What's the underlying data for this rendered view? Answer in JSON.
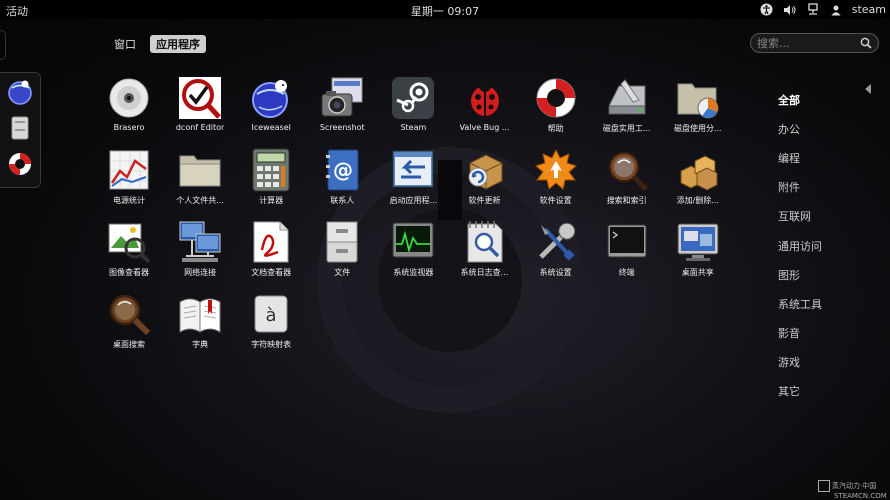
{
  "topbar": {
    "activities": "活动",
    "clock": "星期一 09:07",
    "user": "steam"
  },
  "view_switch": {
    "windows": "窗口",
    "applications": "应用程序"
  },
  "search": {
    "placeholder": "搜索..."
  },
  "apps": [
    {
      "label": "Brasero",
      "icon": "disc-icon"
    },
    {
      "label": "dconf Editor",
      "icon": "dconf-icon"
    },
    {
      "label": "Iceweasel",
      "icon": "iceweasel-icon"
    },
    {
      "label": "Screenshot",
      "icon": "camera-icon"
    },
    {
      "label": "Steam",
      "icon": "steam-icon"
    },
    {
      "label": "Valve Bug ...",
      "icon": "ladybug-icon"
    },
    {
      "label": "帮助",
      "icon": "lifebuoy-icon"
    },
    {
      "label": "磁盘实用工...",
      "icon": "disk-utility-icon"
    },
    {
      "label": "磁盘使用分...",
      "icon": "disk-usage-icon"
    },
    {
      "label": "电源统计",
      "icon": "power-stats-icon"
    },
    {
      "label": "个人文件共...",
      "icon": "folder-share-icon"
    },
    {
      "label": "计算器",
      "icon": "calculator-icon"
    },
    {
      "label": "联系人",
      "icon": "contacts-icon"
    },
    {
      "label": "启动应用程...",
      "icon": "startup-apps-icon"
    },
    {
      "label": "软件更新",
      "icon": "software-update-icon"
    },
    {
      "label": "软件设置",
      "icon": "software-settings-icon"
    },
    {
      "label": "搜索和索引",
      "icon": "search-index-icon"
    },
    {
      "label": "添加/删除...",
      "icon": "packages-icon"
    },
    {
      "label": "图像查看器",
      "icon": "image-viewer-icon"
    },
    {
      "label": "网络连接",
      "icon": "network-icon"
    },
    {
      "label": "文档查看器",
      "icon": "document-viewer-icon"
    },
    {
      "label": "文件",
      "icon": "files-icon"
    },
    {
      "label": "系统监视器",
      "icon": "system-monitor-icon"
    },
    {
      "label": "系统日志查...",
      "icon": "log-viewer-icon"
    },
    {
      "label": "系统设置",
      "icon": "system-settings-icon"
    },
    {
      "label": "终端",
      "icon": "terminal-icon"
    },
    {
      "label": "桌面共享",
      "icon": "desktop-sharing-icon"
    },
    {
      "label": "桌面搜索",
      "icon": "desktop-search-icon"
    },
    {
      "label": "字典",
      "icon": "dictionary-icon"
    },
    {
      "label": "字符映射表",
      "icon": "character-map-icon"
    }
  ],
  "categories": [
    "全部",
    "办公",
    "编程",
    "附件",
    "互联网",
    "通用访问",
    "图形",
    "系统工具",
    "影音",
    "游戏",
    "其它"
  ],
  "dash": [
    "iceweasel-icon",
    "files-icon",
    "lifebuoy-icon"
  ],
  "footer": {
    "line1": "蒸汽动力·中国",
    "line2": "STEAMCN.COM"
  }
}
